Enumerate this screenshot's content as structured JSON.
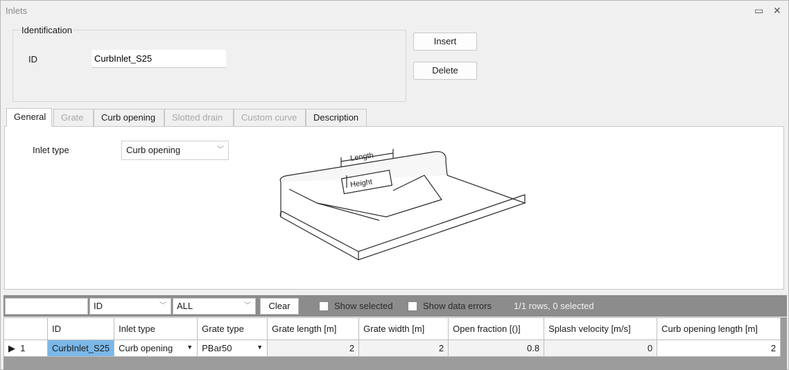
{
  "window": {
    "title": "Inlets",
    "restore_icon": "▭",
    "close_icon": "✕"
  },
  "identification": {
    "group_label": "Identification",
    "id_label": "ID",
    "id_value": "CurbInlet_S25"
  },
  "buttons": {
    "insert": "Insert",
    "delete": "Delete"
  },
  "tabs": [
    {
      "label": "General",
      "state": "active"
    },
    {
      "label": "Grate",
      "state": "disabled"
    },
    {
      "label": "Curb opening",
      "state": "enabled"
    },
    {
      "label": "Slotted drain",
      "state": "disabled"
    },
    {
      "label": "Custom curve",
      "state": "disabled"
    },
    {
      "label": "Description",
      "state": "enabled"
    }
  ],
  "general": {
    "inlet_type_label": "Inlet type",
    "inlet_type_value": "Curb opening",
    "diagram": {
      "length_label": "Length",
      "height_label": "Height"
    }
  },
  "filter": {
    "search_value": "",
    "column_value": "ID",
    "scope_value": "ALL",
    "clear_label": "Clear",
    "show_selected_label": "Show selected",
    "show_selected_checked": false,
    "show_errors_label": "Show data errors",
    "show_errors_checked": false,
    "row_count": "1/1 rows, 0 selected"
  },
  "table": {
    "columns": [
      "",
      "ID",
      "Inlet type",
      "Grate type",
      "Grate length [m]",
      "Grate width [m]",
      "Open fraction [()]",
      "Splash velocity [m/s]",
      "Curb opening length [m]"
    ],
    "rows": [
      {
        "index": "1",
        "id": "CurbInlet_S25",
        "inlet_type": "Curb opening",
        "grate_type": "PBar50",
        "grate_length": "2",
        "grate_width": "2",
        "open_fraction": "0.8",
        "splash_velocity": "0",
        "curb_opening_length": "2"
      }
    ]
  },
  "colors": {
    "selected_cell": "#7bb8e8",
    "filter_bar": "#8c8c8c",
    "panel_bg": "#f0f0f0"
  }
}
